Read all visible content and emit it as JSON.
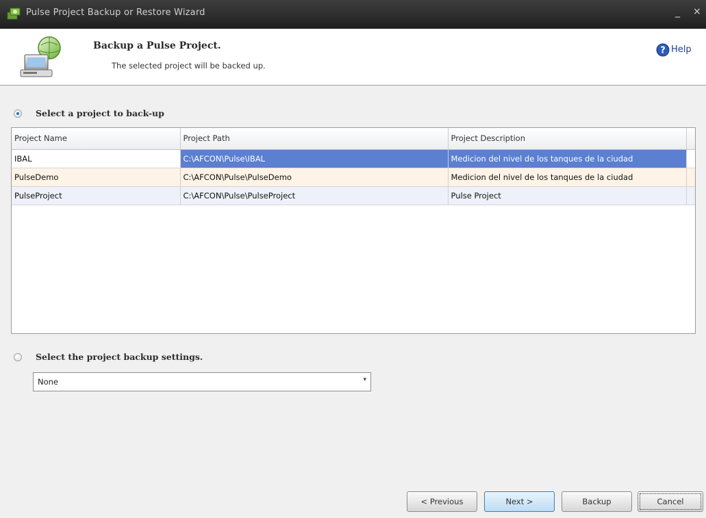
{
  "window": {
    "title": "Pulse Project Backup or Restore Wizard",
    "minimize_glyph": "_",
    "close_glyph": "×"
  },
  "header": {
    "title": "Backup a Pulse Project.",
    "subtitle": "The selected project will be backed up.",
    "help_label": "Help",
    "icons": [
      "backup-computer-icon",
      "help-icon"
    ]
  },
  "section_project": {
    "label": "Select a project to back-up",
    "selected": true
  },
  "table": {
    "columns": [
      "Project Name",
      "Project Path",
      "Project Description"
    ],
    "rows": [
      {
        "name": "IBAL",
        "path": "C:\\AFCON\\Pulse\\IBAL",
        "description": "Medicion del nivel de los tanques de la ciudad"
      },
      {
        "name": "PulseDemo",
        "path": "C:\\AFCON\\Pulse\\PulseDemo",
        "description": "Medicion del nivel de los tanques de la ciudad"
      },
      {
        "name": "PulseProject",
        "path": "C:\\AFCON\\Pulse\\PulseProject",
        "description": "Pulse Project"
      }
    ],
    "selected_row": 0
  },
  "section_settings": {
    "label": "Select the project backup settings.",
    "selected": false,
    "combo_value": "None"
  },
  "buttons": {
    "previous": "< Previous",
    "next": "Next >",
    "backup": "Backup",
    "cancel": "Cancel"
  },
  "colors": {
    "selection": "#5b7fd1",
    "row_alt": "#fdf3e6",
    "row_norm": "#eef1fa",
    "titlebar": "#2b2b2b"
  }
}
